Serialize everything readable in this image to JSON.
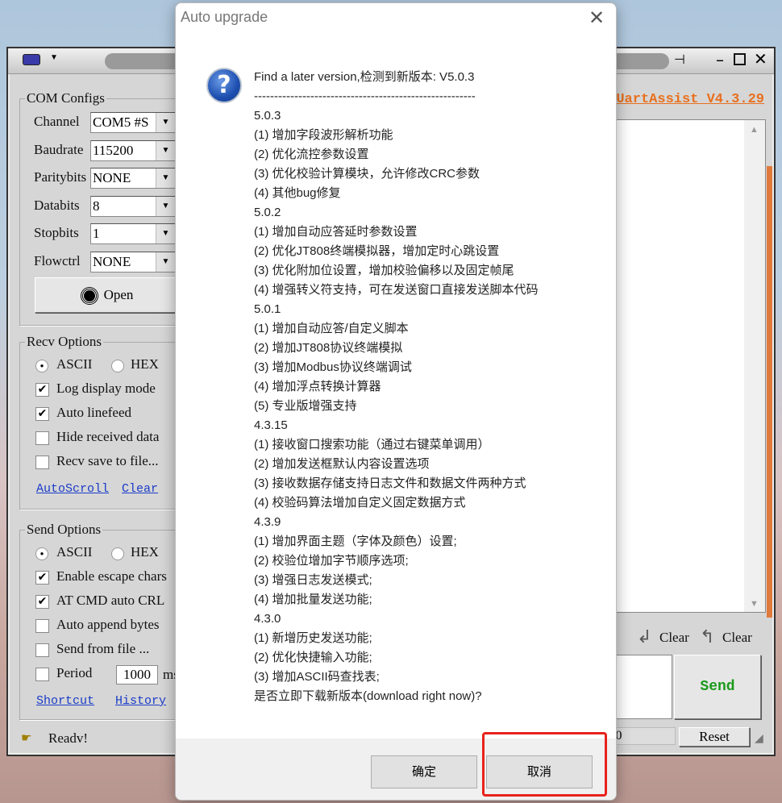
{
  "main_window": {
    "app_title": "UartAssist V4.3.29",
    "accent_color": "#e8701e",
    "com_configs": {
      "title": "COM Configs",
      "rows": [
        {
          "label": "Channel",
          "value": "COM5 #S"
        },
        {
          "label": "Baudrate",
          "value": "115200"
        },
        {
          "label": "Paritybits",
          "value": "NONE"
        },
        {
          "label": "Databits",
          "value": "8"
        },
        {
          "label": "Stopbits",
          "value": "1"
        },
        {
          "label": "Flowctrl",
          "value": "NONE"
        }
      ],
      "open_label": "Open"
    },
    "recv_options": {
      "title": "Recv Options",
      "ascii": "ASCII",
      "hex": "HEX",
      "selected": "ASCII",
      "checks": [
        {
          "label": "Log display mode",
          "checked": true
        },
        {
          "label": "Auto linefeed",
          "checked": true
        },
        {
          "label": "Hide received data",
          "checked": false
        },
        {
          "label": "Recv save to file...",
          "checked": false
        }
      ],
      "autoscroll": "AutoScroll",
      "clear": "Clear"
    },
    "send_options": {
      "title": "Send Options",
      "ascii": "ASCII",
      "hex": "HEX",
      "selected": "ASCII",
      "checks": [
        {
          "label": "Enable escape chars",
          "checked": true
        },
        {
          "label": "AT CMD auto CRL",
          "checked": true
        },
        {
          "label": "Auto append bytes",
          "checked": false
        },
        {
          "label": "Send from file ...",
          "checked": false
        },
        {
          "label": "Period",
          "checked": false
        }
      ],
      "period_value": "1000",
      "period_unit": "ms",
      "shortcut": "Shortcut",
      "history": "History"
    },
    "status": "Readv!",
    "counter": ":0",
    "clear_recv": "Clear",
    "clear_send": "Clear",
    "send_label": "Send",
    "reset_label": "Reset"
  },
  "dialog": {
    "title": "Auto upgrade",
    "lines": [
      "Find a later version,检测到新版本: V5.0.3",
      "-------------------------------------------------------",
      "5.0.3",
      " (1) 增加字段波形解析功能",
      " (2) 优化流控参数设置",
      " (3) 优化校验计算模块，允许修改CRC参数",
      " (4) 其他bug修复",
      "5.0.2",
      " (1) 增加自动应答延时参数设置",
      " (2) 优化JT808终端模拟器，增加定时心跳设置",
      " (3) 优化附加位设置，增加校验偏移以及固定帧尾",
      " (4) 增强转义符支持，可在发送窗口直接发送脚本代码",
      "5.0.1",
      " (1) 增加自动应答/自定义脚本",
      " (2) 增加JT808协议终端模拟",
      " (3) 增加Modbus协议终端调试",
      " (4) 增加浮点转换计算器",
      " (5) 专业版增强支持",
      "4.3.15",
      " (1) 接收窗口搜索功能（通过右键菜单调用）",
      " (2) 增加发送框默认内容设置选项",
      " (3) 接收数据存储支持日志文件和数据文件两种方式",
      " (4) 校验码算法增加自定义固定数据方式",
      "4.3.9",
      " (1) 增加界面主题（字体及颜色）设置;",
      " (2) 校验位增加字节顺序选项;",
      " (3) 增强日志发送模式;",
      " (4) 增加批量发送功能;",
      "4.3.0",
      " (1) 新增历史发送功能;",
      " (2) 优化快捷输入功能;",
      " (3) 增加ASCII码查找表;",
      "是否立即下载新版本(download right now)?"
    ],
    "ok_label": "确定",
    "cancel_label": "取消",
    "highlight_color": "#e8221b"
  }
}
